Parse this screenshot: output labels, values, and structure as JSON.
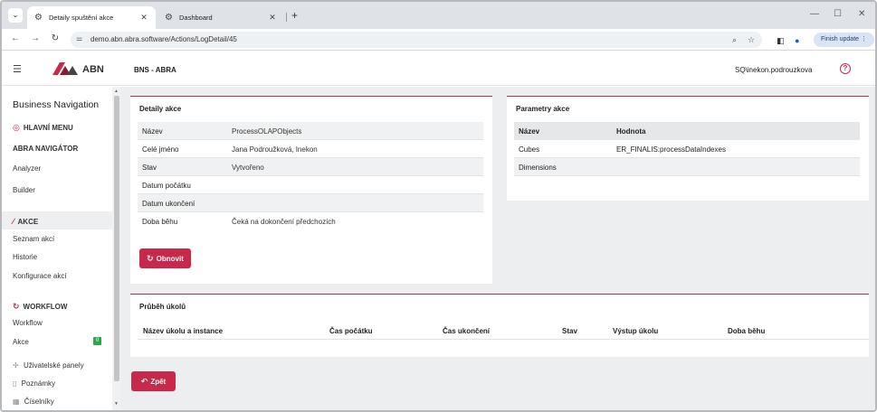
{
  "browser": {
    "tabs": [
      {
        "title": "Detaily spuštění akce",
        "active": true
      },
      {
        "title": "Dashboard",
        "active": false
      }
    ],
    "url": "demo.abn.abra.software/Actions/LogDetail/45",
    "finish_update": "Finish update"
  },
  "app": {
    "logo_text": "ABN",
    "company": "BNS - ABRA",
    "user": "SQ\\inekon.podrouzkova"
  },
  "sidebar": {
    "title": "Business Navigation",
    "main_menu": "HLAVNÍ MENU",
    "navigator": "ABRA NAVIGÁTOR",
    "navigator_items": [
      "Analyzer",
      "Builder"
    ],
    "akce_section": "AKCE",
    "akce_items": [
      "Seznam akcí",
      "Historie",
      "Konfigurace akcí"
    ],
    "workflow_section": "WORKFLOW",
    "workflow_items": [
      "Workflow",
      "Akce"
    ],
    "akce_badge": "0",
    "bottom_items": [
      "Uživatelské panely",
      "Poznámky",
      "Číselníky"
    ]
  },
  "detail": {
    "title": "Detaily akce",
    "rows": [
      {
        "label": "Název",
        "value": "ProcessOLAPObjects"
      },
      {
        "label": "Celé jméno",
        "value": "Jana Podroužková, Inekon"
      },
      {
        "label": "Stav",
        "value": "Vytvořeno"
      },
      {
        "label": "Datum počátku",
        "value": ""
      },
      {
        "label": "Datum ukončení",
        "value": ""
      },
      {
        "label": "Doba běhu",
        "value": "Čeká na dokončení předchozích"
      }
    ],
    "refresh_label": "Obnovit"
  },
  "params": {
    "title": "Parametry akce",
    "header": {
      "name": "Název",
      "value": "Hodnota"
    },
    "rows": [
      {
        "name": "Cubes",
        "value": "ER_FINALIS:processDataIndexes"
      },
      {
        "name": "Dimensions",
        "value": ""
      }
    ]
  },
  "tasks": {
    "title": "Průběh úkolů",
    "columns": [
      "Název úkolu a instance",
      "Čas počátku",
      "Čas ukončení",
      "Stav",
      "Výstup úkolu",
      "Doba běhu"
    ]
  },
  "back_label": "Zpět"
}
